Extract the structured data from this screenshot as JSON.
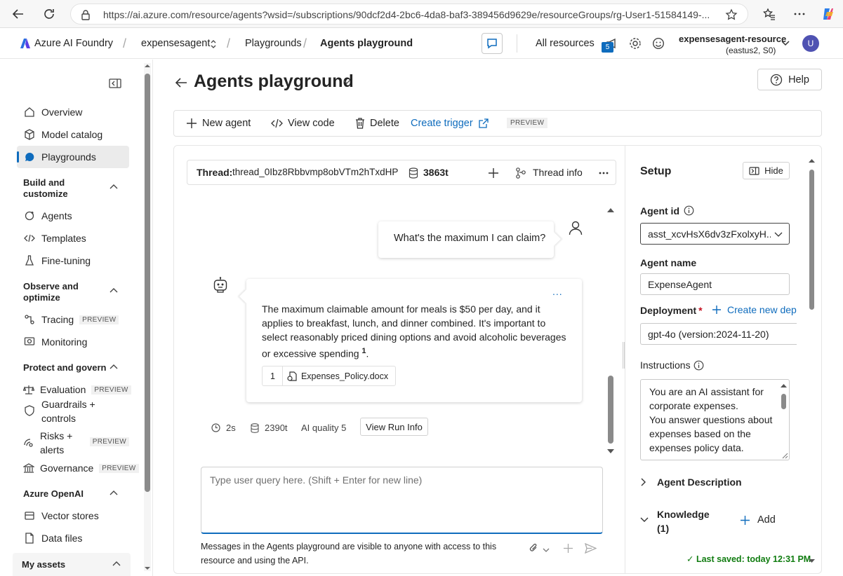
{
  "browser": {
    "url": "https://ai.azure.com/resource/agents?wsid=/subscriptions/90dcf2d4-2bc6-4da8-baf3-389456d9629e/resourceGroups/rg-User1-51584149-..."
  },
  "header": {
    "app_name": "Azure AI Foundry",
    "project": "expensesagent",
    "crumb_playgrounds": "Playgrounds",
    "crumb_current": "Agents playground",
    "all_resources": "All resources",
    "notif_count": "5",
    "resource_name": "expensesagent-resource",
    "resource_region": "(eastus2, S0)",
    "user_initial": "U"
  },
  "sidebar": {
    "overview": "Overview",
    "model_catalog": "Model catalog",
    "playgrounds": "Playgrounds",
    "section_build": "Build and customize",
    "agents": "Agents",
    "templates": "Templates",
    "fine_tuning": "Fine-tuning",
    "section_observe": "Observe and optimize",
    "tracing": "Tracing",
    "monitoring": "Monitoring",
    "section_protect": "Protect and govern",
    "evaluation": "Evaluation",
    "guardrails": "Guardrails + controls",
    "risks": "Risks + alerts",
    "governance": "Governance",
    "section_openai": "Azure OpenAI",
    "vector_stores": "Vector stores",
    "data_files": "Data files",
    "my_assets": "My assets",
    "preview_tag": "PREVIEW"
  },
  "main": {
    "title": "Agents playground",
    "help": "Help",
    "toolbar": {
      "new_agent": "New agent",
      "view_code": "View code",
      "delete": "Delete",
      "create_trigger": "Create trigger",
      "preview": "PREVIEW"
    }
  },
  "thread": {
    "label": "Thread:",
    "id": "thread_0Ibz8Rbbvmp8obVTm2hTxdHP",
    "tokens": "3863t",
    "thread_info": "Thread info"
  },
  "messages": {
    "user_text": "What's the maximum I can claim?",
    "bot_text": "The maximum claimable amount for meals is $50 per day, and it applies to breakfast, lunch, and dinner combined. It's important to select reasonably priced dining options and avoid alcoholic beverages or excessive spending",
    "bot_sup": "1",
    "bot_end": ".",
    "citation_num": "1",
    "citation_file": "Expenses_Policy.docx",
    "meta_time": "2s",
    "meta_tokens": "2390t",
    "meta_quality": "AI quality 5",
    "run_info": "View Run Info",
    "more": "..."
  },
  "query": {
    "placeholder": "Type user query here. (Shift + Enter for new line)",
    "note": "Messages in the Agents playground are visible to anyone with access to this resource and using the API."
  },
  "setup": {
    "title": "Setup",
    "hide": "Hide",
    "agent_id_label": "Agent id",
    "agent_id_value": "asst_xcvHsX6dv3zFxolxyH...",
    "agent_name_label": "Agent name",
    "agent_name_value": "ExpenseAgent",
    "deployment_label": "Deployment",
    "required": "*",
    "create_new_dep": "Create new dep",
    "deployment_value": "gpt-4o (version:2024-11-20)",
    "instructions_label": "Instructions",
    "instructions_text": "You are an AI assistant for corporate expenses.\nYou answer questions about expenses based on the expenses policy data.\nIf a user wants to submit",
    "agent_description": "Agent Description",
    "knowledge_label": "Knowledge (1)",
    "add": "Add",
    "last_saved": "✓ Last saved: today 12:31 PM"
  },
  "colors": {
    "accent": "#0f6cbd",
    "saved_green": "#107c10",
    "required_red": "#c50f1f"
  }
}
